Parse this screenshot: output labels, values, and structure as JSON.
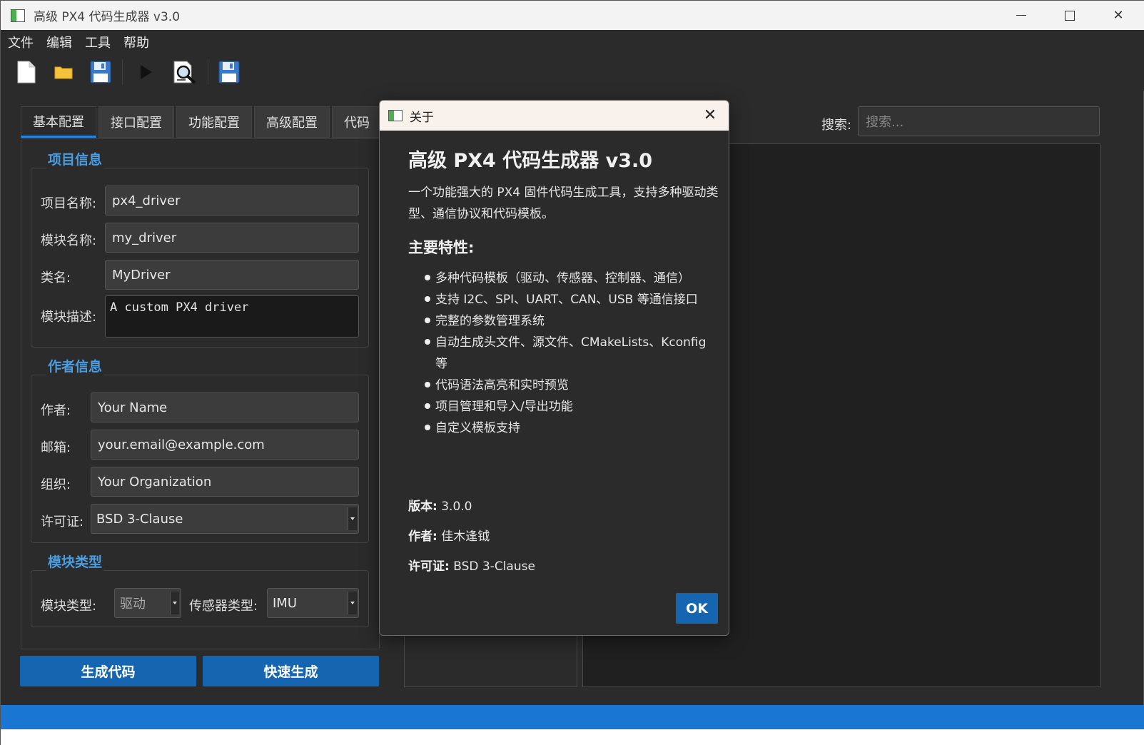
{
  "window": {
    "title": "高级 PX4 代码生成器 v3.0",
    "close_glyph": "✕"
  },
  "menu": [
    "文件",
    "编辑",
    "工具",
    "帮助"
  ],
  "toolbar": {
    "icons": [
      "new-file-icon",
      "open-folder-icon",
      "save-icon",
      "run-icon",
      "preview-icon",
      "save-as-icon"
    ]
  },
  "tabs": [
    "基本配置",
    "接口配置",
    "功能配置",
    "高级配置",
    "代码"
  ],
  "project_info": {
    "title": "项目信息",
    "project_name_label": "项目名称:",
    "project_name": "px4_driver",
    "module_name_label": "模块名称:",
    "module_name": "my_driver",
    "class_name_label": "类名:",
    "class_name": "MyDriver",
    "description_label": "模块描述:",
    "description": "A custom PX4 driver"
  },
  "author_info": {
    "title": "作者信息",
    "author_label": "作者:",
    "author": "Your Name",
    "email_label": "邮箱:",
    "email": "your.email@example.com",
    "org_label": "组织:",
    "org": "Your Organization",
    "license_label": "许可证:",
    "license": "BSD 3-Clause"
  },
  "module_type": {
    "title": "模块类型",
    "type_label": "模块类型:",
    "type_value": "驱动",
    "sensor_label": "传感器类型:",
    "sensor_value": "IMU"
  },
  "actions": {
    "generate": "生成代码",
    "quick_generate": "快速生成"
  },
  "search": {
    "label": "搜索:",
    "placeholder": "搜索..."
  },
  "about_dialog": {
    "title": "关于",
    "heading": "高级 PX4 代码生成器 v3.0",
    "description": "一个功能强大的 PX4 固件代码生成工具，支持多种驱动类型、通信协议和代码模板。",
    "features_title": "主要特性:",
    "features": [
      "多种代码模板（驱动、传感器、控制器、通信）",
      "支持 I2C、SPI、UART、CAN、USB 等通信接口",
      "完整的参数管理系统",
      "自动生成头文件、源文件、CMakeLists、Kconfig 等",
      "代码语法高亮和实时预览",
      "项目管理和导入/导出功能",
      "自定义模板支持"
    ],
    "version_label": "版本:",
    "version": "3.0.0",
    "author_label": "作者:",
    "author": "佳木逢钺",
    "license_label": "许可证:",
    "license": "BSD 3-Clause",
    "ok": "OK"
  },
  "colors": {
    "accent": "#1565b0",
    "status_bar": "#1976d2",
    "group_title": "#4a9de0",
    "background": "#2b2b2b"
  }
}
